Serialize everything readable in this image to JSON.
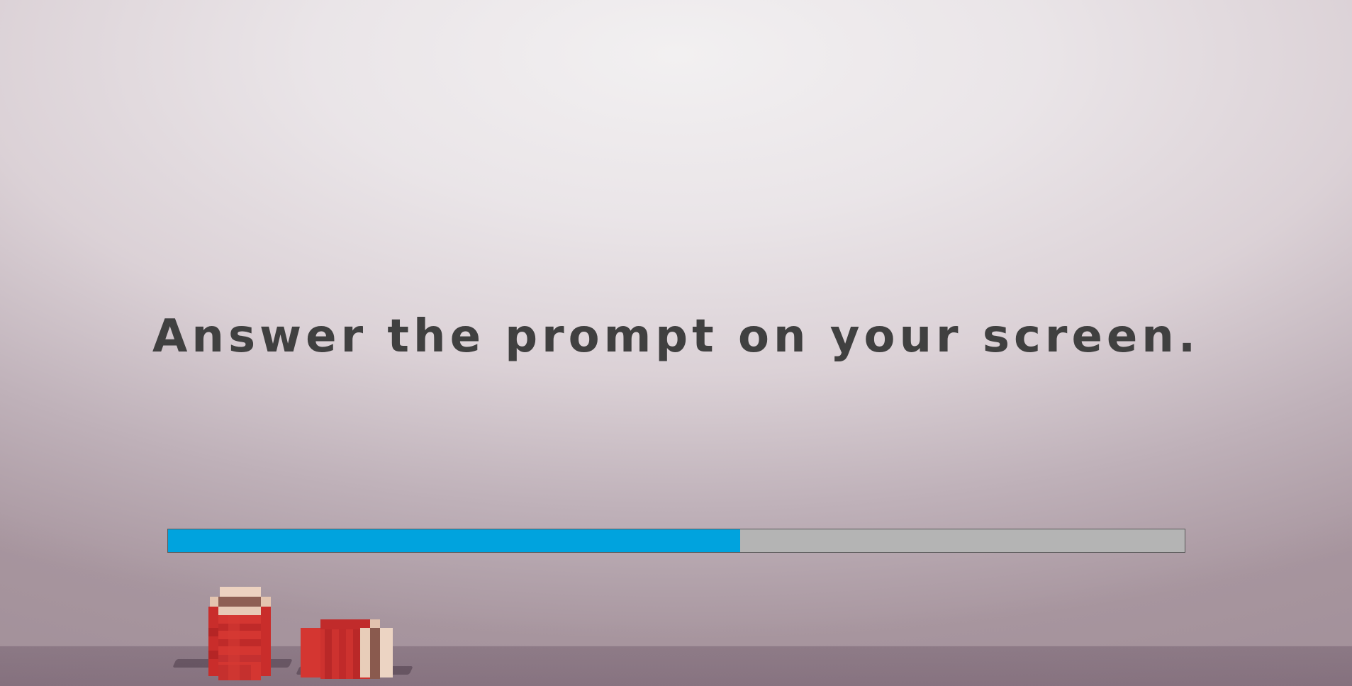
{
  "prompt": {
    "text": "Answer the prompt on your screen."
  },
  "progress": {
    "fraction": 0.563
  },
  "colors": {
    "text": "#404040",
    "progress_fill": "#00a3de",
    "progress_track": "#b4b4b4",
    "player_red": "#d0352f",
    "player_cream": "#e8c9b4",
    "player_brown": "#8a5a4e"
  },
  "characters": [
    {
      "name": "red-player-standing",
      "pose": "standing"
    },
    {
      "name": "red-player-lying",
      "pose": "lying"
    }
  ]
}
